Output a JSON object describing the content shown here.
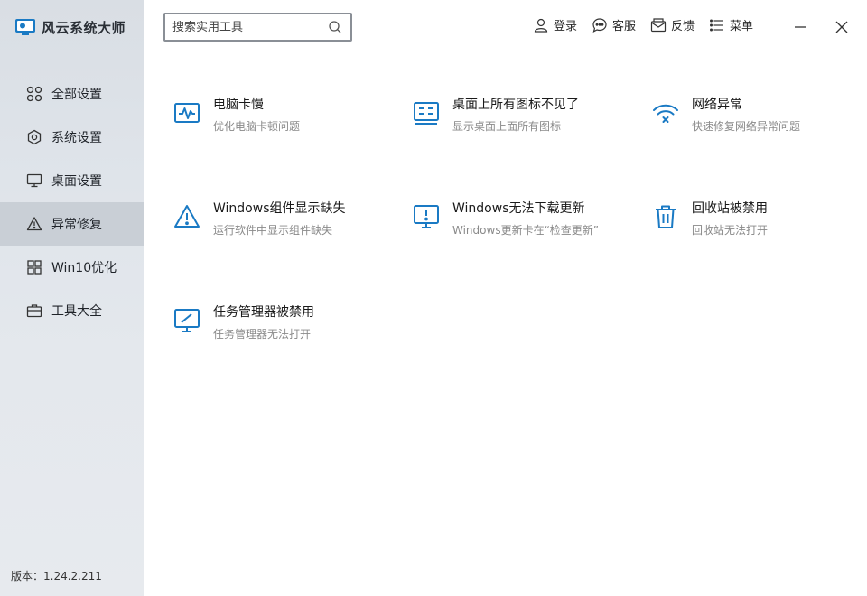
{
  "app": {
    "title": "风云系统大师",
    "version": "版本：1.24.2.211"
  },
  "search": {
    "placeholder": "搜索实用工具"
  },
  "topbar": {
    "actions": [
      {
        "label": "登录",
        "icon": "user-icon"
      },
      {
        "label": "客服",
        "icon": "chat-icon"
      },
      {
        "label": "反馈",
        "icon": "feedback-mail-icon"
      },
      {
        "label": "菜单",
        "icon": "menu-icon"
      }
    ]
  },
  "sidebar": {
    "items": [
      {
        "label": "全部设置",
        "icon": "grid-circles-icon",
        "active": false
      },
      {
        "label": "系统设置",
        "icon": "gear-icon",
        "active": false
      },
      {
        "label": "桌面设置",
        "icon": "monitor-icon",
        "active": false
      },
      {
        "label": "异常修复",
        "icon": "warning-icon",
        "active": true
      },
      {
        "label": "Win10优化",
        "icon": "windows-icon",
        "active": false
      },
      {
        "label": "工具大全",
        "icon": "toolbox-icon",
        "active": false
      }
    ]
  },
  "tools": [
    {
      "title": "电脑卡慢",
      "desc": "优化电脑卡顿问题",
      "icon": "pulse-monitor-icon"
    },
    {
      "title": "桌面上所有图标不见了",
      "desc": "显示桌面上面所有图标",
      "icon": "desktop-list-icon"
    },
    {
      "title": "网络异常",
      "desc": "快速修复网络异常问题",
      "icon": "wifi-error-icon"
    },
    {
      "title": "Windows组件显示缺失",
      "desc": "运行软件中显示组件缺失",
      "icon": "warning-triangle-icon"
    },
    {
      "title": "Windows无法下载更新",
      "desc": "Windows更新卡在“检查更新”",
      "icon": "monitor-alert-icon"
    },
    {
      "title": "回收站被禁用",
      "desc": "回收站无法打开",
      "icon": "recycle-bin-icon"
    },
    {
      "title": "任务管理器被禁用",
      "desc": "任务管理器无法打开",
      "icon": "monitor-slash-icon"
    }
  ],
  "colors": {
    "accent": "#1a7ac4",
    "sidebar_active": "#c9cfd6"
  }
}
